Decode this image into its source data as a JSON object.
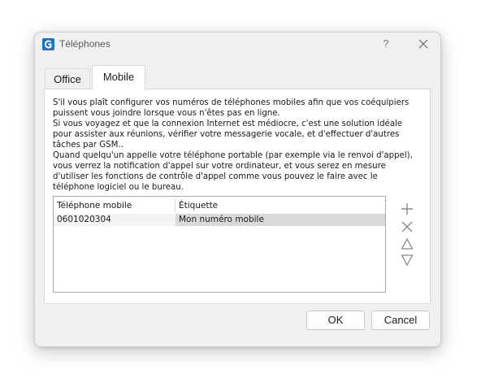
{
  "window": {
    "title": "Téléphones",
    "help_label": "?",
    "accent_color": "#1a73c9"
  },
  "tabs": [
    {
      "label": "Office",
      "selected": false
    },
    {
      "label": "Mobile",
      "selected": true
    }
  ],
  "description": [
    "S'il vous plaît configurer vos numéros de téléphones mobiles afin que vos coéquipiers",
    "puissent vous joindre lorsque vous n'êtes pas en ligne.",
    "Si vous voyagez et que la connexion Internet est médiocre, c'est une solution idéale",
    "pour assister aux réunions, vérifier votre messagerie vocale, et d'effectuer d'autres",
    "tâches par GSM..",
    "Quand quelqu'un appelle votre téléphone portable (par exemple via le renvoi d'appel),",
    "vous verrez la notification d'appel sur votre ordinateur, et vous serez en mesure",
    "d'utiliser les fonctions de contrôle d'appel comme vous pouvez le faire avec le",
    "téléphone logiciel ou le bureau."
  ],
  "table": {
    "columns": [
      "Téléphone mobile",
      "Étiquette"
    ],
    "rows": [
      {
        "phone": "0601020304",
        "label": "Mon numéro mobile"
      }
    ]
  },
  "side_actions": {
    "add_icon": "plus-icon",
    "remove_icon": "x-icon",
    "up_icon": "triangle-up-icon",
    "down_icon": "triangle-down-icon"
  },
  "buttons": {
    "ok": "OK",
    "cancel": "Cancel"
  }
}
